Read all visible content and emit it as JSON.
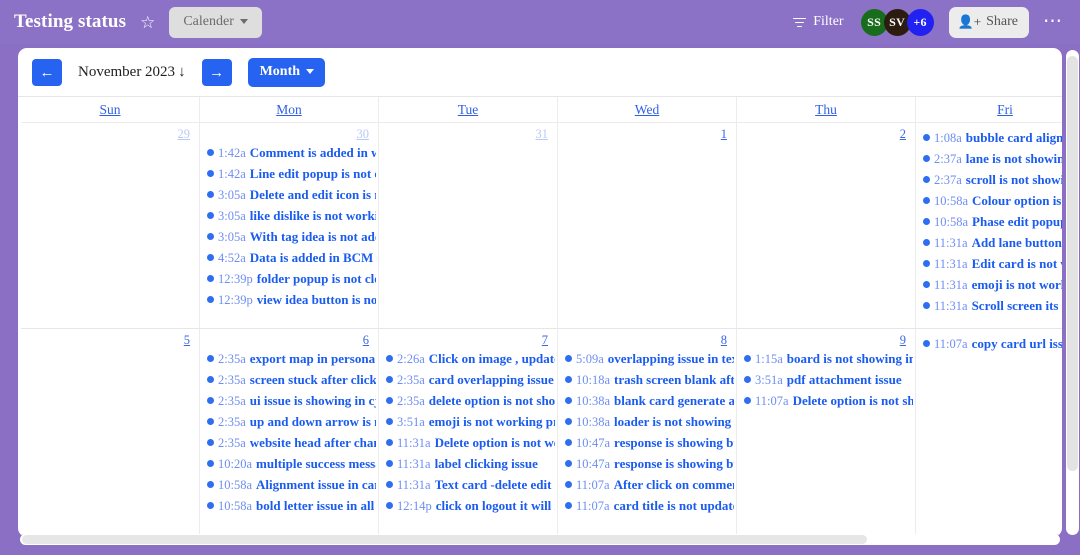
{
  "topbar": {
    "board_title": "Testing status",
    "star_icon": "star-outline-icon",
    "view_chip_label": "Calender",
    "filter_label": "Filter",
    "filter_icon": "funnel-icon",
    "share_label": "Share",
    "share_icon": "person-plus-icon",
    "more_icon": "ellipsis-icon",
    "bar_color": "#8c72c6",
    "avatars": [
      {
        "initials": "SS",
        "color": "#176d1b"
      },
      {
        "initials": "SV",
        "color": "#2c1c10"
      },
      {
        "initials": "+6",
        "color": "#2121f2"
      }
    ]
  },
  "toolbar": {
    "prev_icon": "arrow-left-icon",
    "next_icon": "arrow-right-icon",
    "month_label": "November 2023",
    "month_label_icon": "arrow-down-icon",
    "view_label": "Month",
    "view_caret_icon": "caret-down-icon",
    "accent_color": "#2563f0"
  },
  "calendar": {
    "weekday_headers": [
      "Sun",
      "Mon",
      "Tue",
      "Wed",
      "Thu",
      "Fri"
    ],
    "weeks": [
      {
        "days": [
          {
            "num": "29",
            "muted": true,
            "events": []
          },
          {
            "num": "30",
            "muted": true,
            "events": [
              {
                "time": "1:42a",
                "title": "Comment is added in wrong"
              },
              {
                "time": "1:42a",
                "title": "Line edit popup is not op"
              },
              {
                "time": "3:05a",
                "title": "Delete and edit icon is n"
              },
              {
                "time": "3:05a",
                "title": "like dislike is not working"
              },
              {
                "time": "3:05a",
                "title": "With tag idea is not adde"
              },
              {
                "time": "4:52a",
                "title": "Data is added in BCM aft"
              },
              {
                "time": "12:39p",
                "title": "folder popup is not closi"
              },
              {
                "time": "12:39p",
                "title": "view idea button is not"
              }
            ]
          },
          {
            "num": "31",
            "muted": true,
            "events": []
          },
          {
            "num": "1",
            "muted": false,
            "events": []
          },
          {
            "num": "2",
            "muted": false,
            "events": []
          },
          {
            "num": "",
            "muted": false,
            "events": [
              {
                "time": "1:08a",
                "title": "bubble card alignment"
              },
              {
                "time": "2:37a",
                "title": "lane is not showing"
              },
              {
                "time": "2:37a",
                "title": "scroll is not showing"
              },
              {
                "time": "10:58a",
                "title": "Colour option is not"
              },
              {
                "time": "10:58a",
                "title": "Phase edit popup is"
              },
              {
                "time": "11:31a",
                "title": "Add lane button is"
              },
              {
                "time": "11:31a",
                "title": "Edit card is not wo"
              },
              {
                "time": "11:31a",
                "title": "emoji is not working"
              },
              {
                "time": "11:31a",
                "title": "Scroll screen its ove"
              }
            ]
          }
        ]
      },
      {
        "days": [
          {
            "num": "5",
            "muted": false,
            "events": []
          },
          {
            "num": "6",
            "muted": false,
            "events": [
              {
                "time": "2:35a",
                "title": "export map in persona m"
              },
              {
                "time": "2:35a",
                "title": "screen stuck after click"
              },
              {
                "time": "2:35a",
                "title": "ui issue is showing in cj"
              },
              {
                "time": "2:35a",
                "title": "up and down arrow is m"
              },
              {
                "time": "2:35a",
                "title": "website head after chang"
              },
              {
                "time": "10:20a",
                "title": "multiple success messa"
              },
              {
                "time": "10:58a",
                "title": "Alignment issue in card"
              },
              {
                "time": "10:58a",
                "title": "bold letter issue in all"
              }
            ]
          },
          {
            "num": "7",
            "muted": false,
            "events": [
              {
                "time": "2:26a",
                "title": "Click on image , update i"
              },
              {
                "time": "2:35a",
                "title": "card overlapping issue in"
              },
              {
                "time": "2:35a",
                "title": "delete option is not show"
              },
              {
                "time": "3:51a",
                "title": "emoji is not working pro"
              },
              {
                "time": "11:31a",
                "title": "Delete option is not wo"
              },
              {
                "time": "11:31a",
                "title": "label clicking issue"
              },
              {
                "time": "11:31a",
                "title": "Text card -delete edit c"
              },
              {
                "time": "12:14p",
                "title": "click on logout it will n"
              }
            ]
          },
          {
            "num": "8",
            "muted": false,
            "events": [
              {
                "time": "5:09a",
                "title": "overlapping issue in text"
              },
              {
                "time": "10:18a",
                "title": "trash screen blank afte"
              },
              {
                "time": "10:38a",
                "title": "blank card generate an"
              },
              {
                "time": "10:38a",
                "title": "loader is not showing i"
              },
              {
                "time": "10:47a",
                "title": "response is showing bu"
              },
              {
                "time": "10:47a",
                "title": "response is showing bu"
              },
              {
                "time": "11:07a",
                "title": "After click on comment"
              },
              {
                "time": "11:07a",
                "title": "card title is not update"
              }
            ]
          },
          {
            "num": "9",
            "muted": false,
            "events": [
              {
                "time": "1:15a",
                "title": "board is not showing in"
              },
              {
                "time": "3:51a",
                "title": "pdf attachment issue"
              },
              {
                "time": "11:07a",
                "title": "Delete option is not sh"
              }
            ]
          },
          {
            "num": "",
            "muted": false,
            "events": [
              {
                "time": "11:07a",
                "title": "copy card url issue"
              }
            ]
          }
        ]
      }
    ]
  },
  "scrollbars": {
    "vertical": "vertical-scrollbar",
    "horizontal": "horizontal-scrollbar"
  }
}
